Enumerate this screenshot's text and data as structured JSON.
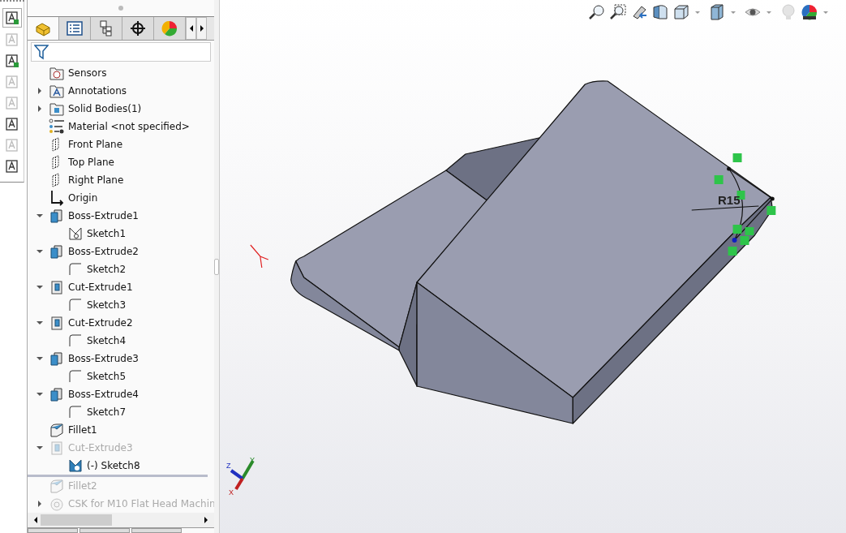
{
  "left_toolbar": {
    "items": [
      {
        "disabled": false
      },
      {
        "disabled": true
      },
      {
        "disabled": false
      },
      {
        "disabled": true
      },
      {
        "disabled": true
      },
      {
        "disabled": false
      },
      {
        "disabled": true
      },
      {
        "disabled": false
      }
    ]
  },
  "panel_tabs": [
    {
      "kind": "feature",
      "selected": true
    },
    {
      "kind": "property",
      "selected": false
    },
    {
      "kind": "config",
      "selected": false
    },
    {
      "kind": "dimxpert",
      "selected": false
    },
    {
      "kind": "display",
      "selected": false
    }
  ],
  "tree": {
    "items": [
      {
        "label": "Sensors",
        "kind": "sensor-folder",
        "suppressed": false
      },
      {
        "label": "Annotations",
        "kind": "annotation-folder",
        "expanded": false,
        "suppressed": false
      },
      {
        "label": "Solid Bodies(1)",
        "kind": "body-folder",
        "expanded": false,
        "suppressed": false
      },
      {
        "label": "Material <not specified>",
        "kind": "material",
        "suppressed": false
      },
      {
        "label": "Front Plane",
        "kind": "plane",
        "suppressed": false
      },
      {
        "label": "Top Plane",
        "kind": "plane",
        "suppressed": false
      },
      {
        "label": "Right Plane",
        "kind": "plane",
        "suppressed": false
      },
      {
        "label": "Origin",
        "kind": "origin",
        "suppressed": false
      },
      {
        "label": "Boss-Extrude1",
        "kind": "boss",
        "expanded": true,
        "suppressed": false,
        "children": [
          {
            "label": "Sketch1",
            "kind": "sketch-point",
            "suppressed": false
          }
        ]
      },
      {
        "label": "Boss-Extrude2",
        "kind": "boss",
        "expanded": true,
        "suppressed": false,
        "children": [
          {
            "label": "Sketch2",
            "kind": "sketch",
            "suppressed": false
          }
        ]
      },
      {
        "label": "Cut-Extrude1",
        "kind": "cut",
        "expanded": true,
        "suppressed": false,
        "children": [
          {
            "label": "Sketch3",
            "kind": "sketch",
            "suppressed": false
          }
        ]
      },
      {
        "label": "Cut-Extrude2",
        "kind": "cut",
        "expanded": true,
        "suppressed": false,
        "children": [
          {
            "label": "Sketch4",
            "kind": "sketch",
            "suppressed": false
          }
        ]
      },
      {
        "label": "Boss-Extrude3",
        "kind": "boss",
        "expanded": true,
        "suppressed": false,
        "children": [
          {
            "label": "Sketch5",
            "kind": "sketch",
            "suppressed": false
          }
        ]
      },
      {
        "label": "Boss-Extrude4",
        "kind": "boss",
        "expanded": true,
        "suppressed": false,
        "children": [
          {
            "label": "Sketch7",
            "kind": "sketch",
            "suppressed": false
          }
        ]
      },
      {
        "label": "Fillet1",
        "kind": "fillet",
        "suppressed": false
      },
      {
        "label": "Cut-Extrude3",
        "kind": "cut",
        "expanded": true,
        "suppressed": true,
        "children": [
          {
            "label": "(-) Sketch8",
            "kind": "sketch-solid",
            "suppressed": false
          }
        ]
      }
    ],
    "rolled_back_items": [
      {
        "label": "Fillet2",
        "kind": "fillet",
        "suppressed": true
      },
      {
        "label": "CSK for M10 Flat Head Machin",
        "kind": "hole",
        "expanded": false,
        "suppressed": true
      }
    ]
  },
  "viewport": {
    "dimension": "R15",
    "triad": {
      "x_label": "X",
      "y_label": "Y",
      "z_label": "Z"
    }
  }
}
